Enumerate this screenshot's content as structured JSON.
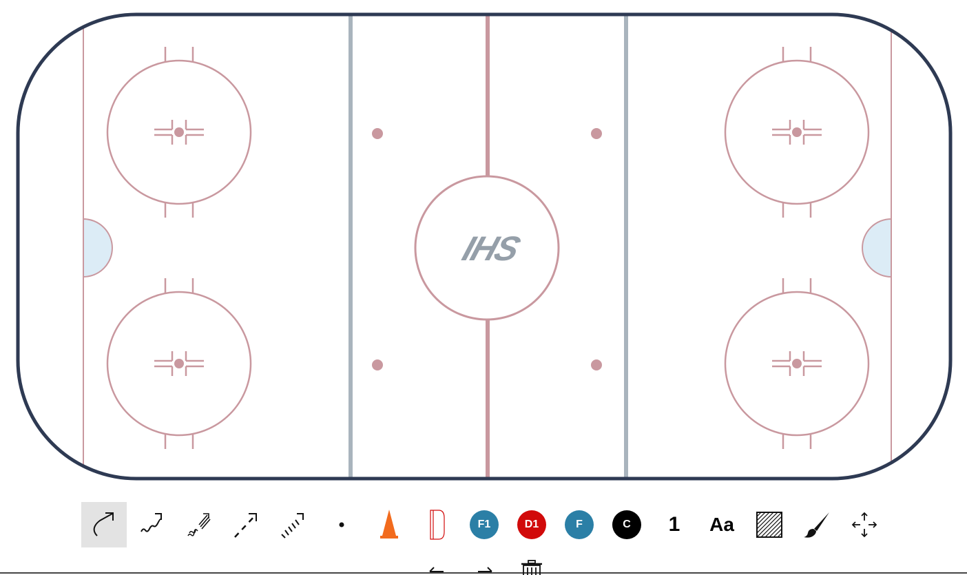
{
  "rink": {
    "logo_text": "IHS",
    "colors": {
      "board": "#2e3a53",
      "red_line": "#c9989f",
      "blue_line": "#a9b4bd",
      "crease": "#dcecf6",
      "logo": "#959fa9"
    }
  },
  "toolbar": {
    "selected_tool": "skate-line",
    "tools": [
      {
        "name": "skate-line",
        "icon": "curved-arrow-icon"
      },
      {
        "name": "skate-with-puck",
        "icon": "wavy-arrow-icon"
      },
      {
        "name": "backward-skate",
        "icon": "wavy-double-line-arrow-icon"
      },
      {
        "name": "pass",
        "icon": "dashed-arrow-icon"
      },
      {
        "name": "shot",
        "icon": "hatched-arrow-icon"
      },
      {
        "name": "puck",
        "icon": "dot-icon"
      },
      {
        "name": "cone",
        "icon": "cone-icon"
      },
      {
        "name": "net",
        "icon": "net-icon"
      },
      {
        "name": "forward-numbered",
        "label": "F1",
        "color": "#2b7fa6"
      },
      {
        "name": "defense-numbered",
        "label": "D1",
        "color": "#d10a0a"
      },
      {
        "name": "forward",
        "label": "F",
        "color": "#2b7fa6"
      },
      {
        "name": "coach",
        "label": "C",
        "color": "#000000"
      },
      {
        "name": "number",
        "label": "1"
      },
      {
        "name": "text",
        "label": "Aa"
      },
      {
        "name": "area",
        "icon": "hatched-square-icon"
      },
      {
        "name": "freehand",
        "icon": "brush-icon"
      },
      {
        "name": "move",
        "icon": "move-arrows-icon"
      }
    ]
  },
  "bottom_controls": [
    {
      "name": "undo",
      "icon": "undo-arrow-icon"
    },
    {
      "name": "redo",
      "icon": "redo-arrow-icon"
    },
    {
      "name": "clear",
      "icon": "trash-icon"
    }
  ]
}
